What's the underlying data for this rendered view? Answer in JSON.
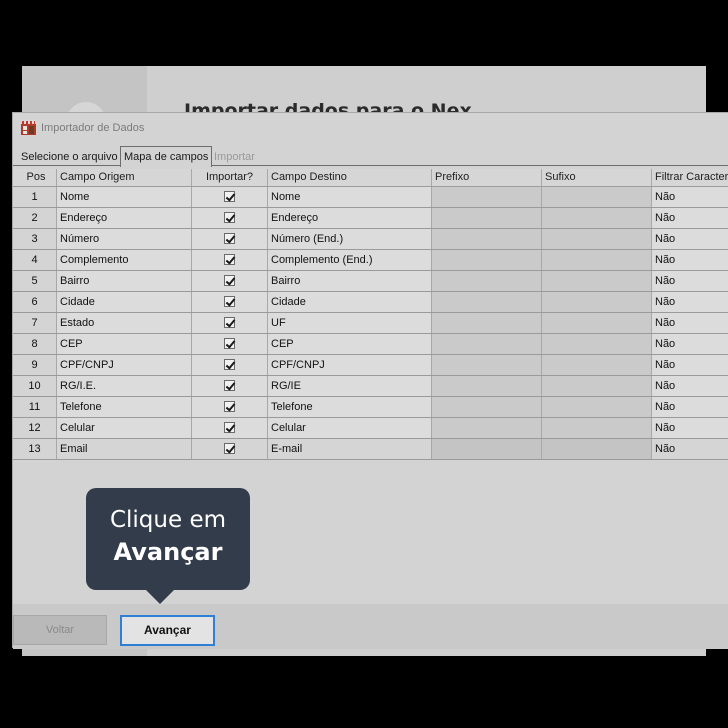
{
  "background": {
    "title": "Importar dados para o Nex"
  },
  "dialog": {
    "title": "Importador de Dados",
    "icon": "store-icon"
  },
  "tabs": [
    {
      "label": "Selecione o arquivo",
      "state": "normal"
    },
    {
      "label": "Mapa de campos",
      "state": "active"
    },
    {
      "label": "Importar",
      "state": "disabled"
    }
  ],
  "grid": {
    "headers": {
      "pos": "Pos",
      "origem": "Campo Origem",
      "importar": "Importar?",
      "destino": "Campo Destino",
      "prefixo": "Prefixo",
      "sufixo": "Sufixo",
      "filtrar": "Filtrar Caracteres"
    },
    "rows": [
      {
        "pos": "1",
        "origem": "Nome",
        "importar": true,
        "destino": "Nome",
        "prefixo": "",
        "sufixo": "",
        "filtrar": "Não"
      },
      {
        "pos": "2",
        "origem": "Endereço",
        "importar": true,
        "destino": "Endereço",
        "prefixo": "",
        "sufixo": "",
        "filtrar": "Não"
      },
      {
        "pos": "3",
        "origem": "Número",
        "importar": true,
        "destino": "Número (End.)",
        "prefixo": "",
        "sufixo": "",
        "filtrar": "Não"
      },
      {
        "pos": "4",
        "origem": "Complemento",
        "importar": true,
        "destino": "Complemento (End.)",
        "prefixo": "",
        "sufixo": "",
        "filtrar": "Não"
      },
      {
        "pos": "5",
        "origem": "Bairro",
        "importar": true,
        "destino": "Bairro",
        "prefixo": "",
        "sufixo": "",
        "filtrar": "Não"
      },
      {
        "pos": "6",
        "origem": "Cidade",
        "importar": true,
        "destino": "Cidade",
        "prefixo": "",
        "sufixo": "",
        "filtrar": "Não"
      },
      {
        "pos": "7",
        "origem": "Estado",
        "importar": true,
        "destino": "UF",
        "prefixo": "",
        "sufixo": "",
        "filtrar": "Não"
      },
      {
        "pos": "8",
        "origem": "CEP",
        "importar": true,
        "destino": "CEP",
        "prefixo": "",
        "sufixo": "",
        "filtrar": "Não"
      },
      {
        "pos": "9",
        "origem": "CPF/CNPJ",
        "importar": true,
        "destino": "CPF/CNPJ",
        "prefixo": "",
        "sufixo": "",
        "filtrar": "Não"
      },
      {
        "pos": "10",
        "origem": "RG/I.E.",
        "importar": true,
        "destino": "RG/IE",
        "prefixo": "",
        "sufixo": "",
        "filtrar": "Não"
      },
      {
        "pos": "11",
        "origem": "Telefone",
        "importar": true,
        "destino": "Telefone",
        "prefixo": "",
        "sufixo": "",
        "filtrar": "Não"
      },
      {
        "pos": "12",
        "origem": "Celular",
        "importar": true,
        "destino": "Celular",
        "prefixo": "",
        "sufixo": "",
        "filtrar": "Não"
      },
      {
        "pos": "13",
        "origem": "Email",
        "importar": true,
        "destino": "E-mail",
        "prefixo": "",
        "sufixo": "",
        "filtrar": "Não"
      }
    ]
  },
  "footer": {
    "back_label": "Voltar",
    "next_label": "Avançar"
  },
  "tooltip": {
    "line1": "Clique em",
    "line2": "Avançar"
  },
  "colors": {
    "tooltip_bg": "#323c4a",
    "focus_border": "#2f7fd6"
  }
}
